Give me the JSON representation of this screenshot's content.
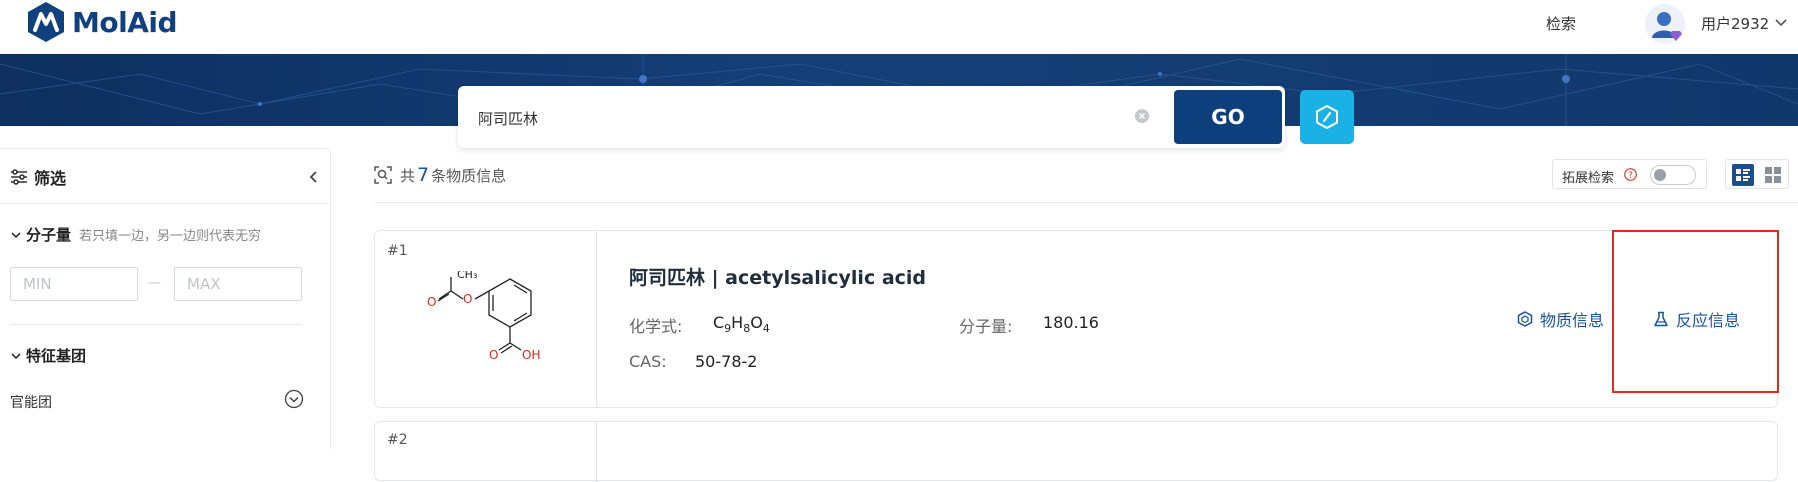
{
  "brand": {
    "name": "MolAid",
    "color": "#11407e"
  },
  "header": {
    "search_label": "检索",
    "username": "用户2932"
  },
  "search": {
    "value": "阿司匹林",
    "go_label": "GO"
  },
  "filter": {
    "title": "筛选",
    "mw": {
      "title": "分子量",
      "hint": "若只填一边，另一边则代表无穷",
      "min_placeholder": "MIN",
      "max_placeholder": "MAX",
      "dash": "—"
    },
    "functional_groups": {
      "title": "特征基团",
      "item": "官能团"
    }
  },
  "results": {
    "prefix": "共",
    "count": "7",
    "suffix": "条物质信息",
    "extended_label": "拓展检索",
    "extended_enabled": false
  },
  "cards": [
    {
      "index": "#1",
      "name": "阿司匹林 | acetylsalicylic acid",
      "formula_label": "化学式:",
      "mw_label": "分子量:",
      "mw_value": "180.16",
      "cas_label": "CAS:",
      "cas_value": "50-78-2",
      "structure_labels": {
        "methyl": "CH₃",
        "o_ester": "O",
        "o_carbonyl": "O",
        "o_acid": "O",
        "oh": "OH"
      },
      "actions": {
        "substance": "物质信息",
        "reaction": "反应信息"
      }
    },
    {
      "index": "#2"
    }
  ],
  "colors": {
    "accent": "#1a54a0",
    "go": "#0d3f7d",
    "draw": "#1ab2e6",
    "highlight": "#e12b1c",
    "heteroatom": "#e3241b"
  }
}
